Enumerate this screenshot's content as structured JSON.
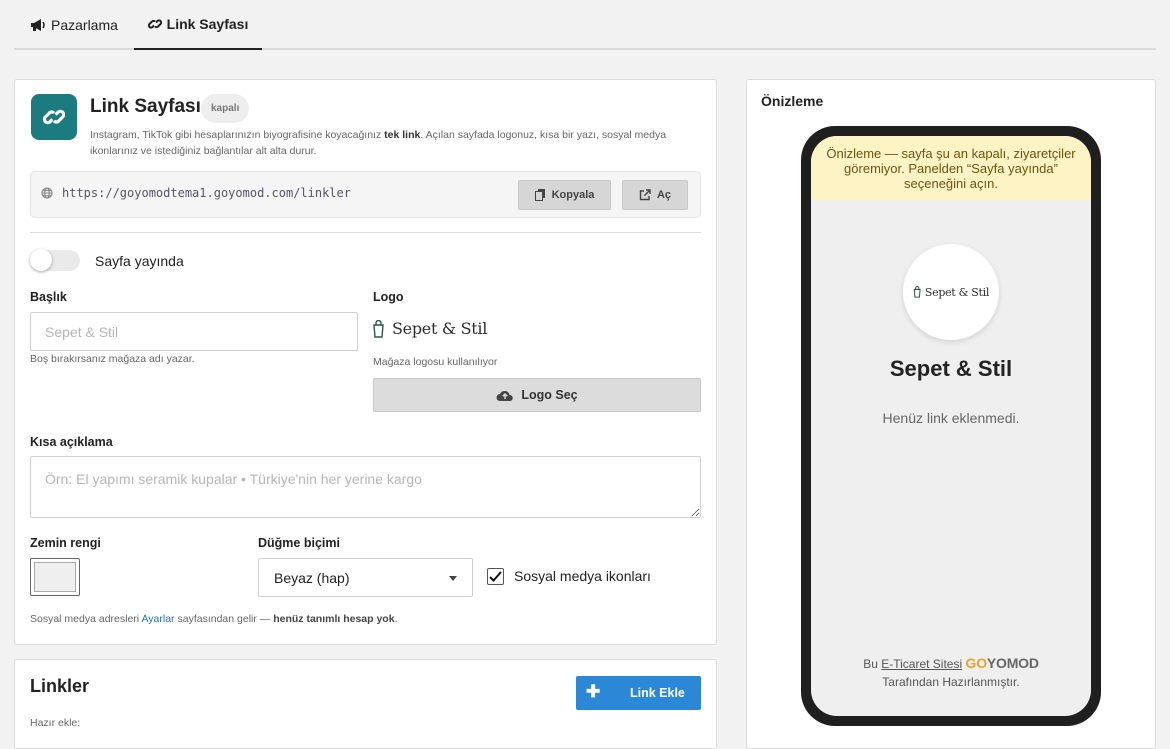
{
  "tabs": [
    {
      "label": "Pazarlama",
      "icon": "megaphone-icon"
    },
    {
      "label": "Link Sayfası",
      "icon": "link-icon",
      "active": true
    }
  ],
  "header": {
    "title": "Link Sayfası",
    "badge": "kapalı",
    "desc_pre": "Instagram, TikTok gibi hesaplarınızın biyografisine koyacağınız ",
    "desc_bold": "tek link",
    "desc_post": ". Açılan sayfada logonuz, kısa bir yazı, sosyal medya ikonlarınız ve istediğiniz bağlantılar alt alta durur."
  },
  "url_box": {
    "url": "https://goyomodtema1.goyomod.com/linkler",
    "copy_label": "Kopyala",
    "open_label": "Aç"
  },
  "publish": {
    "label": "Sayfa yayında",
    "checked": false
  },
  "title_field": {
    "label": "Başlık",
    "placeholder": "Sepet & Stil",
    "value": "",
    "hint": "Boş bırakırsanız mağaza adı yazar."
  },
  "logo": {
    "label": "Logo",
    "brand": "Sepet & Stil",
    "hint": "Mağaza logosu kullanılıyor",
    "button": "Logo Seç"
  },
  "description_field": {
    "label": "Kısa açıklama",
    "placeholder": "Örn: El yapımı seramik kupalar • Türkiye'nin her yerine kargo",
    "value": ""
  },
  "background": {
    "label": "Zemin rengi",
    "color": "#efefef"
  },
  "button_style": {
    "label": "Düğme biçimi",
    "selected": "Beyaz (hap)"
  },
  "social_icons": {
    "label": "Sosyal medya ikonları",
    "checked": true
  },
  "social_note": {
    "pre": "Sosyal medya adresleri ",
    "link": "Ayarlar",
    "mid": " sayfasından gelir — ",
    "bold": "henüz tanımlı hesap yok",
    "post": "."
  },
  "links": {
    "title": "Linkler",
    "add_button": "Link Ekle",
    "quick_add": "Hazır ekle:"
  },
  "preview": {
    "title": "Önizleme",
    "warning": "Önizleme — sayfa şu an kapalı, ziyaretçiler göremiyor. Panelden “Sayfa yayında” seçeneğini açın.",
    "shop_name": "Sepet & Stil",
    "empty_text": "Henüz link eklenmedi.",
    "footer_pre": "Bu",
    "footer_link": "E-Ticaret Sitesi",
    "footer_brand_a": "G",
    "footer_brand_b": "O",
    "footer_brand_c": "YOMOD",
    "footer_post": "Tarafından Hazırlanmıştır."
  },
  "colors": {
    "accent": "#1c7b7f",
    "primary_button": "#2a88d6",
    "warning_bg": "#fdf3c4",
    "link": "#2a6fa8"
  }
}
